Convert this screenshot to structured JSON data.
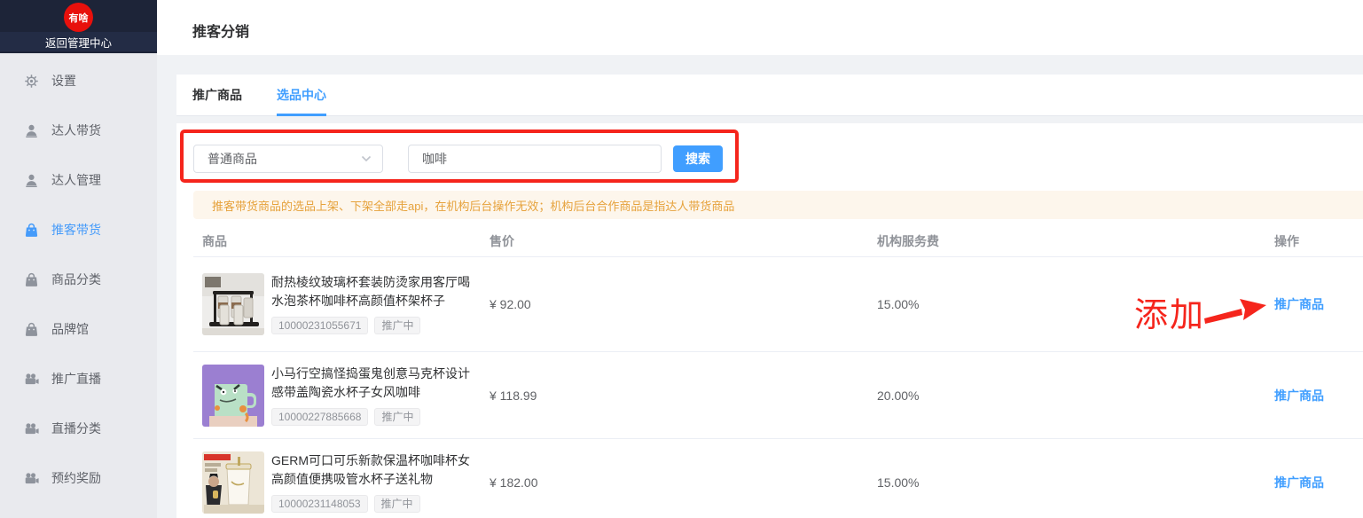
{
  "colors": {
    "accent": "#409eff",
    "annotation_red": "#f5251c",
    "notice_bg": "#fdf6ec",
    "notice_text": "#e6a23c",
    "sidebar_dark": "#1d2438",
    "logo_red": "#e8100c"
  },
  "sidebar": {
    "logo_text": "有啥",
    "back_label": "返回管理中心",
    "items": [
      {
        "label": "设置",
        "icon": "gear-icon",
        "active": false
      },
      {
        "label": "达人带货",
        "icon": "person-icon",
        "active": false
      },
      {
        "label": "达人管理",
        "icon": "person-icon",
        "active": false
      },
      {
        "label": "推客带货",
        "icon": "bag-icon",
        "active": true
      },
      {
        "label": "商品分类",
        "icon": "bag-icon",
        "active": false
      },
      {
        "label": "品牌馆",
        "icon": "bag-icon",
        "active": false
      },
      {
        "label": "推广直播",
        "icon": "camera-icon",
        "active": false
      },
      {
        "label": "直播分类",
        "icon": "camera-icon",
        "active": false
      },
      {
        "label": "预约奖励",
        "icon": "camera-icon",
        "active": false
      }
    ]
  },
  "header": {
    "title": "推客分销"
  },
  "tabs": [
    {
      "label": "推广商品",
      "active": false
    },
    {
      "label": "选品中心",
      "active": true
    }
  ],
  "search": {
    "category_value": "普通商品",
    "keyword_value": "咖啡",
    "button_label": "搜索"
  },
  "notice": "推客带货商品的选品上架、下架全部走api，在机构后台操作无效；机构后台合作商品是指达人带货商品",
  "table": {
    "columns": [
      "商品",
      "售价",
      "机构服务费",
      "操作"
    ],
    "rows": [
      {
        "title": "耐热棱纹玻璃杯套装防烫家用客厅喝水泡茶杯咖啡杯高颜值杯架杯子",
        "id": "10000231055671",
        "status": "推广中",
        "price": "¥ 92.00",
        "fee": "15.00%",
        "action": "推广商品"
      },
      {
        "title": "小马行空搞怪捣蛋鬼创意马克杯设计感带盖陶瓷水杯子女风咖啡",
        "id": "10000227885668",
        "status": "推广中",
        "price": "¥ 118.99",
        "fee": "20.00%",
        "action": "推广商品"
      },
      {
        "title": "GERM可口可乐新款保温杯咖啡杯女高颜值便携吸管水杯子送礼物",
        "id": "10000231148053",
        "status": "推广中",
        "price": "¥ 182.00",
        "fee": "15.00%",
        "action": "推广商品"
      }
    ]
  },
  "annotations": {
    "add_label": "添加"
  }
}
